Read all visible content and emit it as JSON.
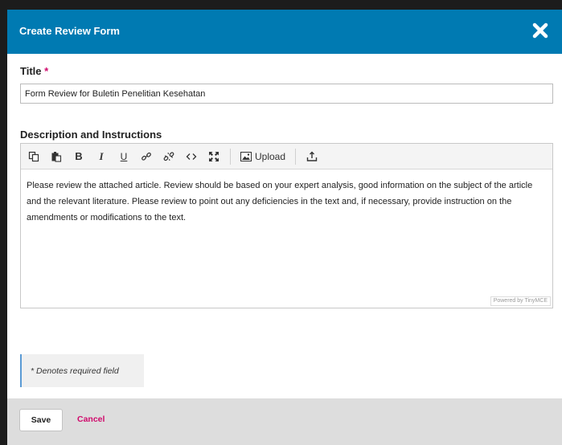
{
  "modal": {
    "title": "Create Review Form",
    "close_icon": "close-icon"
  },
  "form": {
    "title_label": "Title",
    "required_marker": "*",
    "title_value": "Form Review for Buletin Penelitian Kesehatan",
    "description_label": "Description and Instructions",
    "description_text": "Please review the attached article. Review should be based on your expert analysis, good information on the subject of the article and the relevant literature. Please review to point out any deficiencies in the text and, if necessary, provide instruction on the amendments or modifications to the text.",
    "powered_by": "Powered by TinyMCE",
    "required_note": "* Denotes required field"
  },
  "toolbar": {
    "buttons": [
      {
        "name": "copy-icon"
      },
      {
        "name": "paste-icon"
      },
      {
        "name": "bold-icon",
        "glyph": "B"
      },
      {
        "name": "italic-icon",
        "glyph": "I"
      },
      {
        "name": "underline-icon",
        "glyph": "U"
      },
      {
        "name": "link-icon"
      },
      {
        "name": "unlink-icon"
      },
      {
        "name": "code-icon"
      },
      {
        "name": "fullscreen-icon"
      },
      {
        "name": "image-icon"
      },
      {
        "name": "download-icon"
      }
    ],
    "upload_label": "Upload"
  },
  "footer": {
    "save_label": "Save",
    "cancel_label": "Cancel"
  },
  "colors": {
    "header": "#007ab2",
    "accent": "#d00a6c",
    "footer_bg": "#dddddd"
  }
}
